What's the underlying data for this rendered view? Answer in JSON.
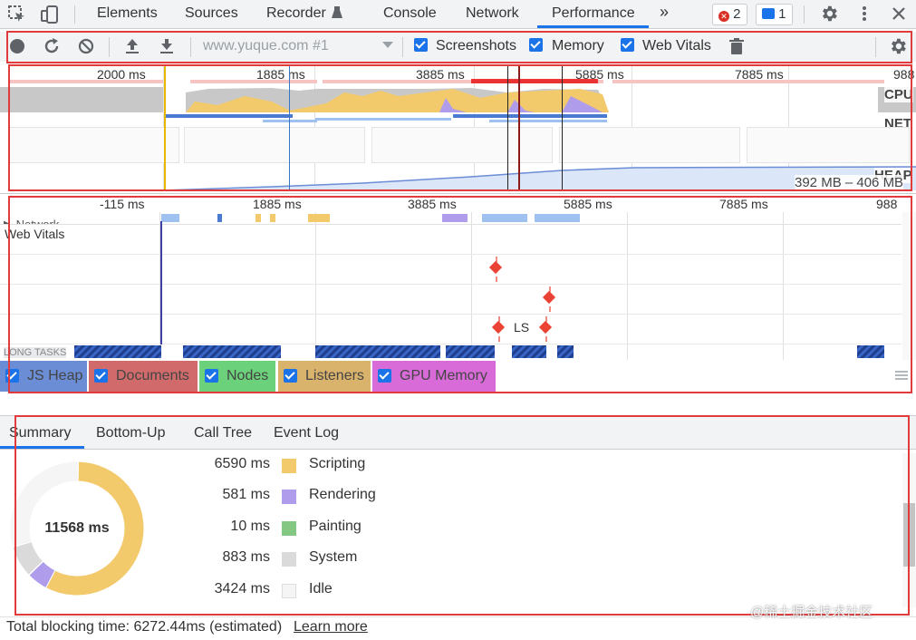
{
  "tabs": {
    "items": [
      "Elements",
      "Sources",
      "Recorder",
      "Console",
      "Network",
      "Performance"
    ],
    "more": "»",
    "errors_count": "2",
    "messages_count": "1"
  },
  "toolbar": {
    "url_select": "www.yuque.com #1",
    "screenshots_label": "Screenshots",
    "memory_label": "Memory",
    "web_vitals_label": "Web Vitals"
  },
  "overview": {
    "ticks": [
      "2000 ms",
      "1885 ms",
      "3885 ms",
      "5885 ms",
      "7885 ms",
      "988"
    ],
    "cpu_label": "CPU",
    "net_label": "NET",
    "heap_label": "HEAP",
    "heap_range": "392 MB – 406 MB"
  },
  "timeline": {
    "ticks": [
      "-115 ms",
      "1885 ms",
      "3885 ms",
      "5885 ms",
      "7885 ms",
      "988"
    ],
    "network_label": "Network",
    "web_vitals_label": "Web Vitals",
    "ls_label": "LS",
    "long_tasks_label": "LONG TASKS"
  },
  "memory_legend": [
    {
      "label": "JS Heap",
      "color": "#6b8dd6"
    },
    {
      "label": "Documents",
      "color": "#d16b6b"
    },
    {
      "label": "Nodes",
      "color": "#6bd17a"
    },
    {
      "label": "Listeners",
      "color": "#d9b26b"
    },
    {
      "label": "GPU Memory",
      "color": "#d96bd9"
    }
  ],
  "bottom_tabs": [
    "Summary",
    "Bottom-Up",
    "Call Tree",
    "Event Log"
  ],
  "summary": {
    "total": "11568 ms",
    "rows": [
      {
        "value": "6590 ms",
        "name": "Scripting",
        "color": "#f2ca6b"
      },
      {
        "value": "581 ms",
        "name": "Rendering",
        "color": "#af9ceb"
      },
      {
        "value": "10 ms",
        "name": "Painting",
        "color": "#84c783"
      },
      {
        "value": "883 ms",
        "name": "System",
        "color": "#dadada"
      },
      {
        "value": "3424 ms",
        "name": "Idle",
        "color": "#f5f5f5"
      }
    ]
  },
  "footer": {
    "blocking_text": "Total blocking time: 6272.44ms (estimated)",
    "learn_more": "Learn more",
    "watermark": "@稀土掘金技术社区"
  }
}
